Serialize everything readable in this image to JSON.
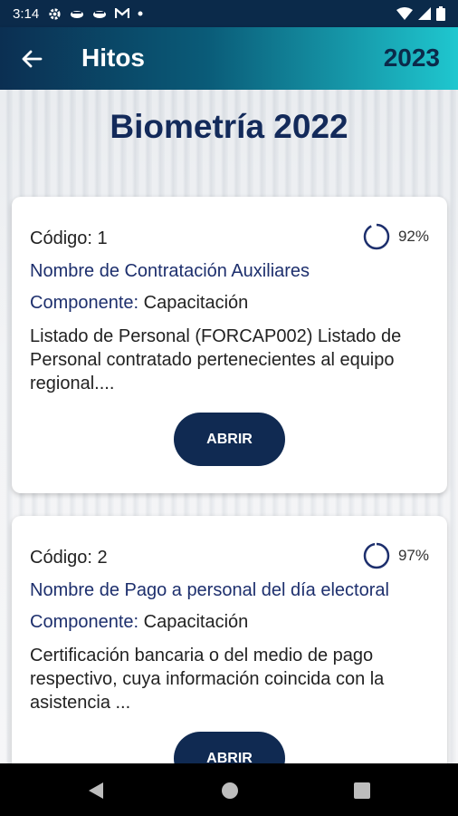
{
  "status_bar": {
    "time": "3:14",
    "icons": [
      "gear-icon",
      "cloud-icon",
      "cloud-icon",
      "gmail-icon",
      "dot-icon"
    ],
    "right_icons": [
      "wifi-icon",
      "signal-icon",
      "battery-icon"
    ]
  },
  "app_bar": {
    "title": "Hitos",
    "year": "2023",
    "back_icon": "arrow-left-icon"
  },
  "page": {
    "title": "Biometría 2022"
  },
  "cards": [
    {
      "code": "Código: 1",
      "progress": 92,
      "progress_label": "92%",
      "contract": "Nombre de Contratación Auxiliares",
      "component_label": "Componente:",
      "component_value": "Capacitación",
      "description": "Listado de Personal  (FORCAP002) Listado de Personal contratado  pertenecientes al equipo regional....",
      "button_label": "ABRIR"
    },
    {
      "code": "Código: 2",
      "progress": 97,
      "progress_label": "97%",
      "contract": "Nombre de Pago a personal del día electoral",
      "component_label": "Componente:",
      "component_value": "Capacitación",
      "description": "Certificación bancaria o del medio de pago respectivo, cuya información coincida con la asistencia ...",
      "button_label": "ABRIR"
    }
  ],
  "nav_bar": {
    "buttons": [
      "back-triangle-icon",
      "home-circle-icon",
      "recents-square-icon"
    ]
  },
  "colors": {
    "primary": "#102a52",
    "accent": "#1fc7cf",
    "title": "#132a5a"
  }
}
